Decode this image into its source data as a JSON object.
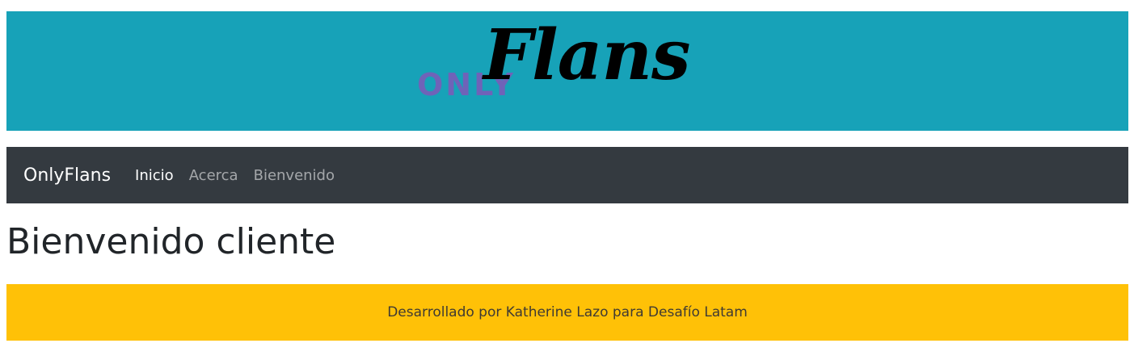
{
  "banner": {
    "logo_only": "ONLY",
    "logo_flans": "Flans",
    "background_color": "#17a2b8",
    "only_color": "#6f63b8"
  },
  "navbar": {
    "brand": "OnlyFlans",
    "links": [
      {
        "label": "Inicio",
        "active": true
      },
      {
        "label": "Acerca",
        "active": false
      },
      {
        "label": "Bienvenido",
        "active": false
      }
    ],
    "background_color": "#343a40"
  },
  "main": {
    "title": "Bienvenido cliente"
  },
  "footer": {
    "text": "Desarrollado por Katherine Lazo para Desafío Latam",
    "background_color": "#ffc107"
  }
}
